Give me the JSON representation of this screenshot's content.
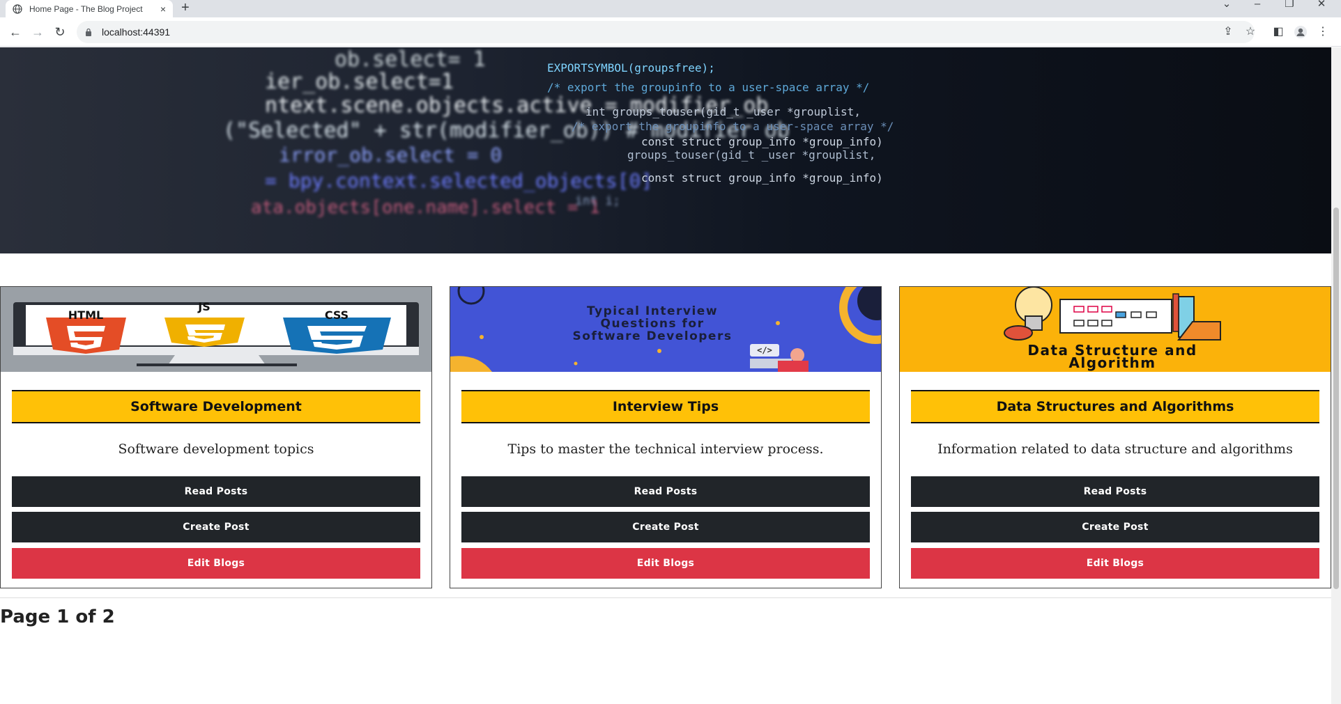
{
  "browser": {
    "tab_title": "Home Page - The Blog Project",
    "tab_close": "×",
    "new_tab": "+",
    "url": "localhost:44391",
    "win_controls": {
      "dropdown": "⌄",
      "minimize": "–",
      "restore": "❐",
      "close": "✕"
    },
    "nav": {
      "back": "←",
      "forward": "→",
      "reload": "↻"
    },
    "toolbar_icons": {
      "share": "⇪",
      "star": "☆",
      "sidepanel": "◧",
      "menu": "⋮"
    }
  },
  "hero": {
    "code_lines": [
      "ob.select= 1",
      "ier_ob.select=1",
      "ntext.scene.objects.active = modifier_ob",
      "(\"Selected\" + str(modifier_ob)) # modifier ob",
      "irror_ob.select = 0",
      "= bpy.context.selected_objects[0]",
      "ata.objects[one.name].select = 1",
      "EXPORTSYMBOL(groupsfree);",
      "/* export the groupinfo to a user-space array */",
      "int groups_touser(gid_t _user *grouplist,",
      "/* export the groupinfo to a user-space array */",
      "const struct group_info *group_info)",
      "groups_touser(gid_t _user *grouplist,",
      "const struct group_info *group_info)",
      "int i;"
    ]
  },
  "cards": [
    {
      "image_words": [
        "HTML",
        "JS",
        "CSS"
      ],
      "name": "Software Development",
      "description": "Software development topics",
      "read_label": "Read Posts",
      "create_label": "Create Post",
      "edit_label": "Edit Blogs"
    },
    {
      "image_lines": [
        "Typical Interview",
        "Questions for",
        "Software Developers"
      ],
      "image_tag": "</>",
      "name": "Interview Tips",
      "description": "Tips to master the technical interview process.",
      "read_label": "Read Posts",
      "create_label": "Create Post",
      "edit_label": "Edit Blogs"
    },
    {
      "image_lines": [
        "Data Structure and",
        "Algorithm"
      ],
      "name": "Data Structures and Algorithms",
      "description": "Information related to data structure and algorithms",
      "read_label": "Read Posts",
      "create_label": "Create Post",
      "edit_label": "Edit Blogs"
    }
  ],
  "pagination": {
    "text": "Page 1 of 2"
  },
  "colors": {
    "accent": "#ffc107",
    "dark_button": "#212529",
    "danger_button": "#dc3545"
  }
}
